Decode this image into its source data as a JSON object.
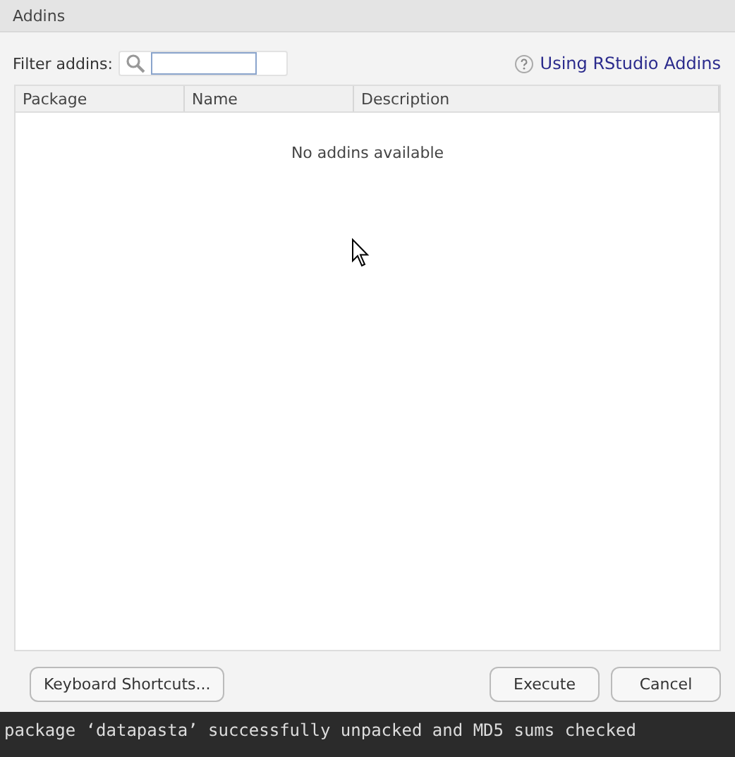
{
  "window": {
    "title": "Addins"
  },
  "filter": {
    "label": "Filter addins:"
  },
  "help_link": {
    "label": "Using RStudio Addins"
  },
  "table": {
    "columns": [
      "Package",
      "Name",
      "Description"
    ],
    "empty_message": "No addins available"
  },
  "buttons": {
    "left": "Keyboard Shortcuts...",
    "execute": "Execute",
    "cancel": "Cancel"
  },
  "console": {
    "line": "package ‘datapasta’ successfully unpacked and MD5 sums checked"
  }
}
